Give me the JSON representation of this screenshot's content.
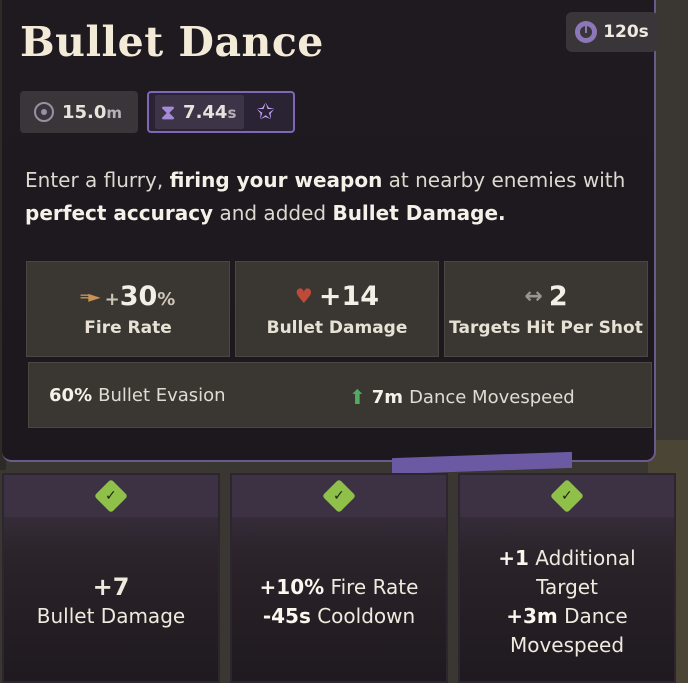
{
  "ability": {
    "title": "Bullet Dance",
    "cooldown": "120s",
    "range_value": "15.0",
    "range_unit": "m",
    "duration_value": "7.44",
    "duration_unit": "s"
  },
  "description": {
    "p1": "Enter a flurry, ",
    "b1": "firing your weapon",
    "p2": " at nearby enemies with ",
    "b2": "perfect accuracy",
    "p3": " and added ",
    "b3": "Bullet Damage."
  },
  "stats": [
    {
      "prefix": "+",
      "value": "30",
      "suffix": "%",
      "label": "Fire Rate",
      "icon": "fire-rate-icon"
    },
    {
      "prefix": "",
      "value": "+14",
      "suffix": "",
      "label": "Bullet Damage",
      "icon": "bullet-damage-icon"
    },
    {
      "prefix": "",
      "value": "2",
      "suffix": "",
      "label": "Targets Hit Per Shot",
      "icon": "arrows-icon"
    }
  ],
  "extras": {
    "evasion_value": "60",
    "evasion_unit": "%",
    "evasion_label": "Bullet Evasion",
    "movespeed_value": "7",
    "movespeed_unit": "m",
    "movespeed_label": "Dance Movespeed"
  },
  "upgrades": [
    {
      "line1": "+7",
      "line2": "Bullet Damage"
    },
    {
      "l1_bold": "+10%",
      "l1_text": " Fire Rate",
      "l2_bold": "-45s",
      "l2_text": " Cooldown"
    },
    {
      "l1_bold": "+1",
      "l1_text": " Additional",
      "l2": "Target",
      "l3_bold": "+3m",
      "l3_text": " Dance",
      "l4": "Movespeed"
    }
  ],
  "colors": {
    "accent_purple": "#7f67b6",
    "check_green": "#8ec04a",
    "panel": "#1e1a20"
  }
}
